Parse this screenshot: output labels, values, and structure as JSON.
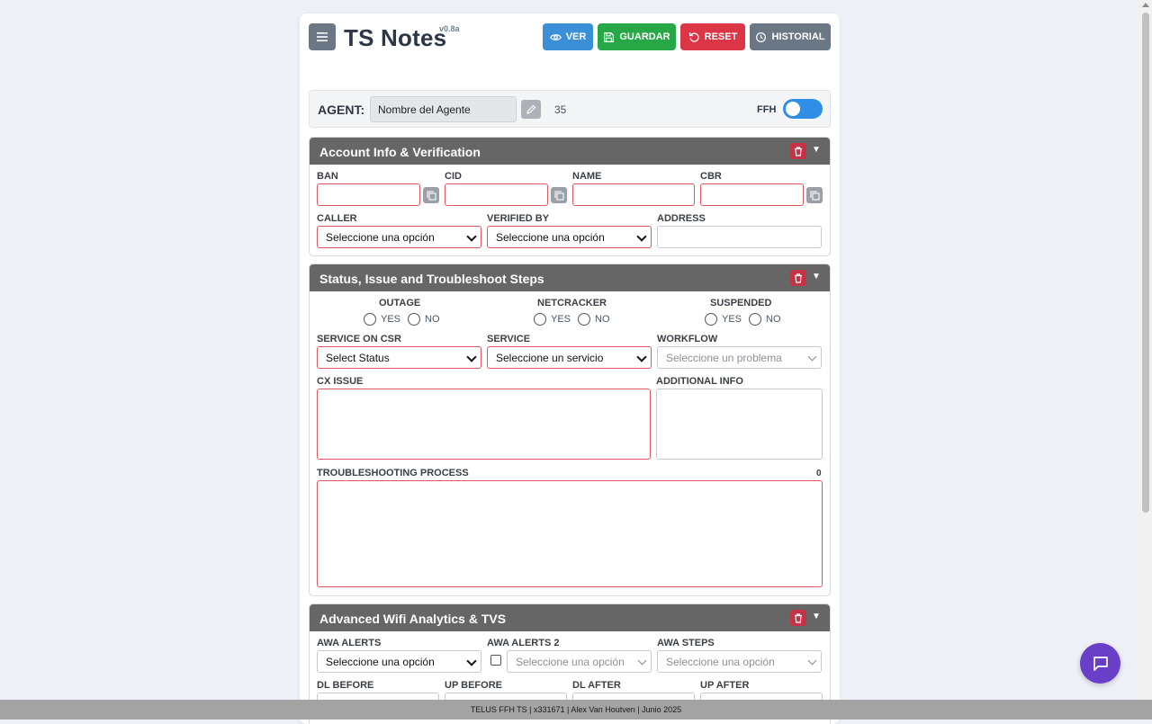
{
  "header": {
    "title": "TS Notes",
    "version": "v0.8a",
    "buttons": {
      "ver": "VER",
      "guardar": "GUARDAR",
      "reset": "RESET",
      "historial": "HISTORIAL"
    }
  },
  "agent": {
    "label": "AGENT:",
    "name_value": "Nombre del Agente",
    "count": "35",
    "ffh_label": "FFH",
    "ffh_enabled": true
  },
  "sections": {
    "account": {
      "title": "Account Info & Verification",
      "labels": {
        "ban": "BAN",
        "cid": "CID",
        "name": "NAME",
        "cbr": "CBR",
        "caller": "CALLER",
        "verified_by": "VERIFIED BY",
        "address": "ADDRESS"
      },
      "caller_value": "Seleccione una opción",
      "verified_by_value": "Seleccione una opción"
    },
    "status": {
      "title": "Status, Issue and Troubleshoot Steps",
      "outage": "OUTAGE",
      "netcracker": "NETCRACKER",
      "suspended": "SUSPENDED",
      "yes": "YES",
      "no": "NO",
      "labels": {
        "service_on_csr": "SERVICE ON CSR",
        "service": "SERVICE",
        "workflow": "WORKFLOW",
        "cx_issue": "CX ISSUE",
        "additional_info": "ADDITIONAL INFO",
        "troubleshooting": "TROUBLESHOOTING PROCESS"
      },
      "service_on_csr_value": "Select Status",
      "service_value": "Seleccione un servicio",
      "workflow_value": "Seleccione un problema",
      "troubleshooting_count": "0"
    },
    "awa": {
      "title": "Advanced Wifi Analytics & TVS",
      "labels": {
        "awa_alerts": "AWA ALERTS",
        "awa_alerts_2": "AWA ALERTS 2",
        "awa_steps": "AWA STEPS",
        "dl_before": "DL BEFORE",
        "up_before": "UP BEFORE",
        "dl_after": "DL AFTER",
        "up_after": "UP AFTER"
      },
      "awa_alerts_value": "Seleccione una opción",
      "awa_alerts_2_value": "Seleccione una opción",
      "awa_steps_value": "Seleccione una opción"
    }
  },
  "footer": {
    "text": "TELUS FFH TS | x331671 | Alex Van Houtven | Junio 2025"
  },
  "colors": {
    "ver": "#3a8fd6",
    "guardar": "#27a745",
    "reset": "#dc3545",
    "historial": "#6b7785",
    "section_header": "#666666",
    "chat": "#6a3fc8"
  }
}
